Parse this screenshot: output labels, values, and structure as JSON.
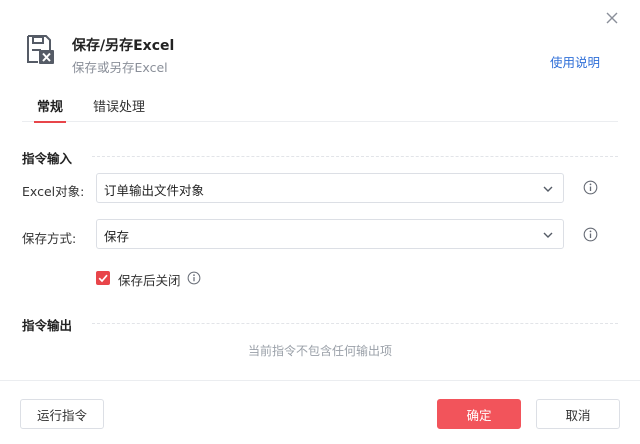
{
  "dialog": {
    "title": "保存/另存Excel",
    "subtitle": "保存或另存Excel",
    "help_link": "使用说明"
  },
  "tabs": [
    {
      "label": "常规",
      "active": true
    },
    {
      "label": "错误处理",
      "active": false
    }
  ],
  "input_section": {
    "title": "指令输入",
    "fields": [
      {
        "label": "Excel对象:",
        "value": "订单输出文件对象"
      },
      {
        "label": "保存方式:",
        "value": "保存"
      }
    ],
    "checkbox": {
      "label": "保存后关闭",
      "checked": true
    }
  },
  "output_section": {
    "title": "指令输出",
    "empty_text": "当前指令不包含任何输出项"
  },
  "footer": {
    "run_label": "运行指令",
    "ok_label": "确定",
    "cancel_label": "取消"
  },
  "colors": {
    "accent": "#e8454a",
    "primary_button": "#f2545b",
    "link": "#2f6fd8"
  },
  "icons": {
    "app": "excel-save-icon",
    "close": "close-icon",
    "dropdown": "chevron-down-icon",
    "info": "info-icon",
    "check": "check-icon"
  }
}
